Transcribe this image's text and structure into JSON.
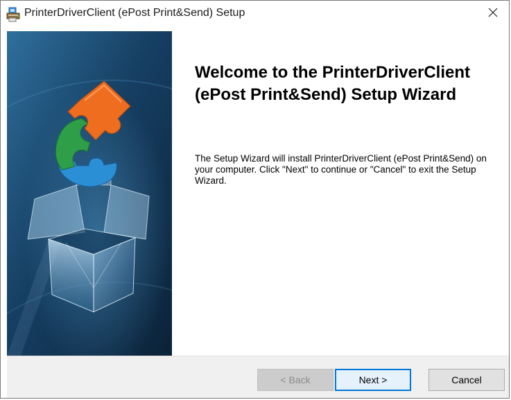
{
  "window": {
    "title": "PrinterDriverClient (ePost Print&Send) Setup"
  },
  "welcome": {
    "heading": "Welcome to the PrinterDriverClient (ePost Print&Send) Setup Wizard",
    "description": "The Setup Wizard will install PrinterDriverClient (ePost Print&Send) on your computer.  Click \"Next\" to continue or \"Cancel\" to exit the Setup Wizard."
  },
  "buttons": {
    "back": "< Back",
    "next": "Next >",
    "cancel": "Cancel"
  },
  "icons": {
    "app": "installer-icon",
    "close": "close-icon",
    "banner": "box-with-puzzle-banner"
  },
  "colors": {
    "banner_dark": "#0d2a45",
    "banner_light": "#2f6f9c",
    "puzzle_orange": "#ee6d1f",
    "puzzle_green": "#2e9e48",
    "puzzle_blue": "#2b8fd6",
    "button_focus": "#0078d7",
    "footer_bg": "#f0f0f0"
  },
  "state": {
    "back_enabled": false,
    "default_button": "next"
  }
}
